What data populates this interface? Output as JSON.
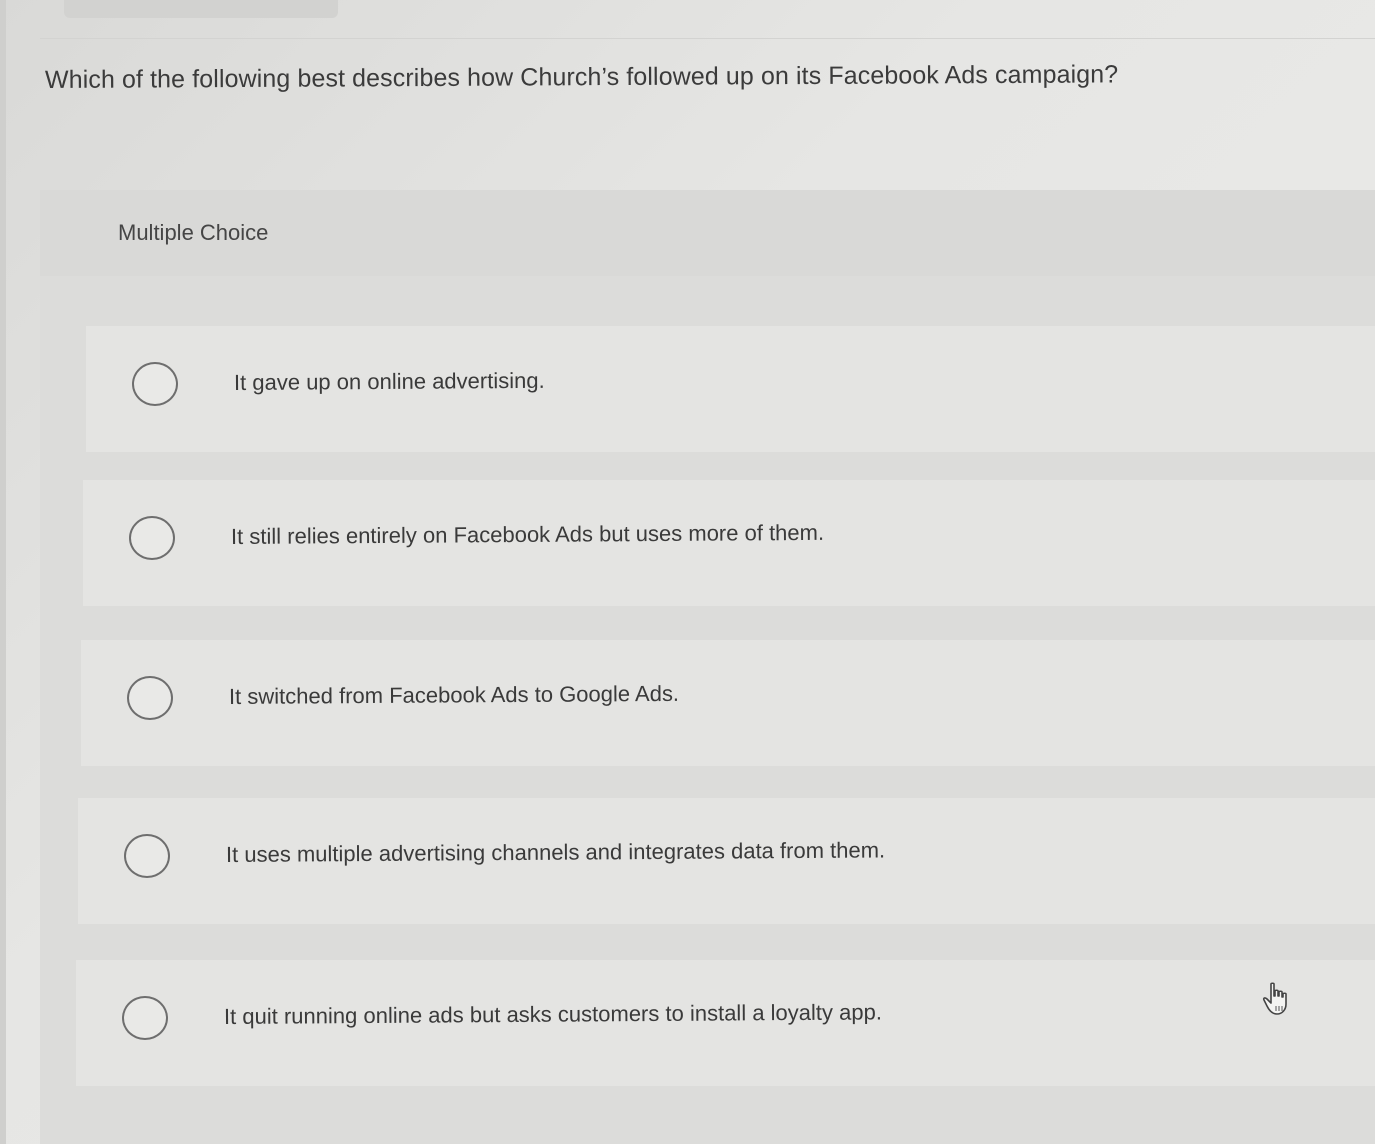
{
  "question": {
    "text": "Which of the following best describes how Church’s followed up on its Facebook Ads campaign?"
  },
  "choices": {
    "label": "Multiple Choice",
    "options": [
      {
        "text": "It gave up on online advertising.",
        "selected": false
      },
      {
        "text": "It still relies entirely on Facebook Ads but uses more of them.",
        "selected": false
      },
      {
        "text": "It switched from Facebook Ads to Google Ads.",
        "selected": false
      },
      {
        "text": "It uses multiple advertising channels and integrates data from them.",
        "selected": false
      },
      {
        "text": "It quit running online ads but asks customers to install a loyalty app.",
        "selected": false
      }
    ]
  },
  "icons": {
    "radio": "radio-unchecked-icon",
    "cursor": "hand-pointer-cursor-icon"
  },
  "colors": {
    "text": "#3a3a3a",
    "radio_border": "#6e6e6e",
    "panel": "#dcdcda",
    "option_bg": "#e4e4e2"
  }
}
